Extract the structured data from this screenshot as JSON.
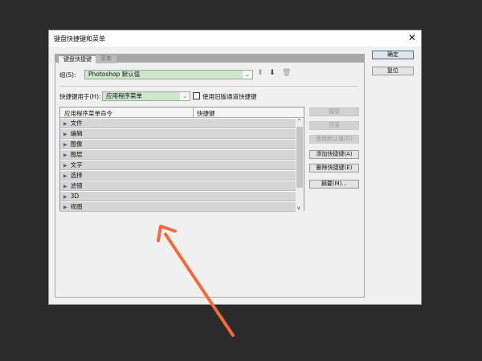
{
  "dialog": {
    "title": "键盘快捷键和菜单"
  },
  "tabs": [
    {
      "label": "键盘快捷键",
      "active": true
    },
    {
      "label": "菜单",
      "active": false
    }
  ],
  "group": {
    "label": "组(S):",
    "value": "Photoshop 默认值"
  },
  "shortcuts_for": {
    "label": "快捷键用于(H):",
    "value": "应用程序菜单",
    "legacy_checkbox_label": "使用旧版通道快捷键",
    "legacy_checked": false
  },
  "table": {
    "columns": [
      "应用程序菜单命令",
      "快捷键"
    ],
    "rows": [
      "文件",
      "编辑",
      "图像",
      "图层",
      "文字",
      "选择",
      "滤镜",
      "3D",
      "视图"
    ]
  },
  "side_buttons": [
    {
      "label": "接受",
      "enabled": false
    },
    {
      "label": "还原",
      "enabled": false
    },
    {
      "label": "使用默认值(D)",
      "enabled": false
    },
    {
      "label": "添加快捷键(A)",
      "enabled": true
    },
    {
      "label": "删除快捷键(E)",
      "enabled": true
    },
    {
      "label": "摘要(M)...",
      "enabled": true
    }
  ],
  "ok_label": "确定",
  "reset_label": "复位",
  "colors": {
    "combo_bg": "#cde6cd",
    "annotation_arrow": "#f26b3a"
  }
}
